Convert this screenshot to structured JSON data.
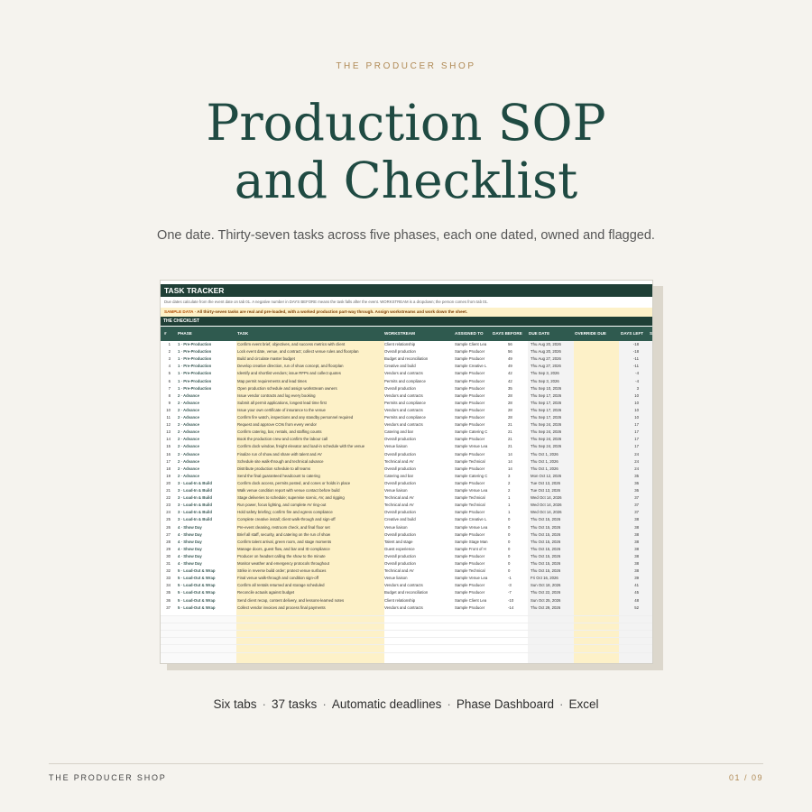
{
  "brand": "THE PRODUCER SHOP",
  "title_line1": "Production SOP",
  "title_line2": "and Checklist",
  "subtitle": "One date. Thirty-seven tasks across five phases, each one dated, owned and flagged.",
  "sheet": {
    "title": "TASK TRACKER",
    "note": "Due dates calculate from the event date on tab 01. A negative number in DAYS BEFORE means the task falls after the event. WORKSTREAM is a dropdown; the person comes from tab 01.",
    "sample_tag": "SAMPLE DATA",
    "sample_text": "All thirty-seven tasks are real and pre-loaded, with a worked production part-way through. Assign workstreams and work down the sheet.",
    "section": "THE CHECKLIST",
    "headers": [
      "#",
      "PHASE",
      "TASK",
      "WORKSTREAM",
      "ASSIGNED TO",
      "DAYS BEFORE",
      "DUE DATE",
      "OVERRIDE DUE",
      "DAYS LEFT",
      "S"
    ],
    "rows": [
      [
        "1",
        "1 · Pre-Production",
        "Confirm event brief, objectives, and success metrics with client",
        "Client relationship",
        "Sample Client Lea",
        "56",
        "Thu  Aug 20, 2026",
        "-18"
      ],
      [
        "2",
        "1 · Pre-Production",
        "Lock event date, venue, and contract; collect venue rules and floorplan",
        "Overall production",
        "Sample Producer",
        "56",
        "Thu  Aug 20, 2026",
        "-18"
      ],
      [
        "3",
        "1 · Pre-Production",
        "Build and circulate master budget",
        "Budget and reconciliation",
        "Sample Producer",
        "49",
        "Thu  Aug 27, 2026",
        "-11"
      ],
      [
        "4",
        "1 · Pre-Production",
        "Develop creative direction, run of show concept, and floorplan",
        "Creative and build",
        "Sample Creative L",
        "49",
        "Thu  Aug 27, 2026",
        "-11"
      ],
      [
        "5",
        "1 · Pre-Production",
        "Identify and shortlist vendors; issue RFPs and collect quotes",
        "Vendors and contracts",
        "Sample Producer",
        "42",
        "Thu  Sep 3, 2026",
        "-4"
      ],
      [
        "6",
        "1 · Pre-Production",
        "Map permit requirements and lead times",
        "Permits and compliance",
        "Sample Producer",
        "42",
        "Thu  Sep 3, 2026",
        "-4"
      ],
      [
        "7",
        "1 · Pre-Production",
        "Open production schedule and assign workstream owners",
        "Overall production",
        "Sample Producer",
        "35",
        "Thu  Sep 10, 2026",
        "3"
      ],
      [
        "8",
        "2 · Advance",
        "Issue vendor contracts and log every booking",
        "Vendors and contracts",
        "Sample Producer",
        "28",
        "Thu  Sep 17, 2026",
        "10"
      ],
      [
        "9",
        "2 · Advance",
        "Submit all permit applications, longest lead time first",
        "Permits and compliance",
        "Sample Producer",
        "28",
        "Thu  Sep 17, 2026",
        "10"
      ],
      [
        "10",
        "2 · Advance",
        "Issue your own certificate of insurance to the venue",
        "Vendors and contracts",
        "Sample Producer",
        "28",
        "Thu  Sep 17, 2026",
        "10"
      ],
      [
        "11",
        "2 · Advance",
        "Confirm fire watch, inspections and any standby personnel required",
        "Permits and compliance",
        "Sample Producer",
        "28",
        "Thu  Sep 17, 2026",
        "10"
      ],
      [
        "12",
        "2 · Advance",
        "Request and approve COIs from every vendor",
        "Vendors and contracts",
        "Sample Producer",
        "21",
        "Thu  Sep 24, 2026",
        "17"
      ],
      [
        "13",
        "2 · Advance",
        "Confirm catering, bar, rentals, and staffing counts",
        "Catering and bar",
        "Sample Catering C",
        "21",
        "Thu  Sep 24, 2026",
        "17"
      ],
      [
        "14",
        "2 · Advance",
        "Book the production crew and confirm the labour call",
        "Overall production",
        "Sample Producer",
        "21",
        "Thu  Sep 24, 2026",
        "17"
      ],
      [
        "15",
        "2 · Advance",
        "Confirm dock window, freight elevator and load-in schedule with the venue",
        "Venue liaison",
        "Sample Venue Lea",
        "21",
        "Thu  Sep 24, 2026",
        "17"
      ],
      [
        "16",
        "2 · Advance",
        "Finalize run of show and share with talent and AV",
        "Overall production",
        "Sample Producer",
        "14",
        "Thu  Oct 1, 2026",
        "24"
      ],
      [
        "17",
        "2 · Advance",
        "Schedule site walk-through and technical advance",
        "Technical and AV",
        "Sample Technical",
        "14",
        "Thu  Oct 1, 2026",
        "24"
      ],
      [
        "18",
        "2 · Advance",
        "Distribute production schedule to all teams",
        "Overall production",
        "Sample Producer",
        "14",
        "Thu  Oct 1, 2026",
        "24"
      ],
      [
        "19",
        "2 · Advance",
        "Send the final guaranteed headcount to catering",
        "Catering and bar",
        "Sample Catering C",
        "3",
        "Mon  Oct 12, 2026",
        "35"
      ],
      [
        "20",
        "3 · Load-In & Build",
        "Confirm dock access, permits posted, and cones or holds in place",
        "Overall production",
        "Sample Producer",
        "2",
        "Tue  Oct 13, 2026",
        "36"
      ],
      [
        "21",
        "3 · Load-In & Build",
        "Walk venue condition report with venue contact before build",
        "Venue liaison",
        "Sample Venue Lea",
        "2",
        "Tue  Oct 13, 2026",
        "36"
      ],
      [
        "22",
        "3 · Load-In & Build",
        "Stage deliveries to schedule; supervise scenic, AV, and rigging",
        "Technical and AV",
        "Sample Technical",
        "1",
        "Wed  Oct 14, 2026",
        "37"
      ],
      [
        "23",
        "3 · Load-In & Build",
        "Run power, focus lighting, and complete AV ring-out",
        "Technical and AV",
        "Sample Technical",
        "1",
        "Wed  Oct 14, 2026",
        "37"
      ],
      [
        "24",
        "3 · Load-In & Build",
        "Hold safety briefing; confirm fire and egress compliance",
        "Overall production",
        "Sample Producer",
        "1",
        "Wed  Oct 14, 2026",
        "37"
      ],
      [
        "25",
        "3 · Load-In & Build",
        "Complete creative install; client walk-through and sign-off",
        "Creative and build",
        "Sample Creative L",
        "0",
        "Thu  Oct 15, 2026",
        "38"
      ],
      [
        "26",
        "4 · Show Day",
        "Pre-event cleaning, restroom check, and final floor set",
        "Venue liaison",
        "Sample Venue Lea",
        "0",
        "Thu  Oct 15, 2026",
        "38"
      ],
      [
        "27",
        "4 · Show Day",
        "Brief all staff, security, and catering on the run of show",
        "Overall production",
        "Sample Producer",
        "0",
        "Thu  Oct 15, 2026",
        "38"
      ],
      [
        "28",
        "4 · Show Day",
        "Confirm talent arrival, green room, and stage moments",
        "Talent and stage",
        "Sample Stage Man",
        "0",
        "Thu  Oct 15, 2026",
        "38"
      ],
      [
        "29",
        "4 · Show Day",
        "Manage doors, guest flow, and bar and ID compliance",
        "Guest experience",
        "Sample Front of H",
        "0",
        "Thu  Oct 15, 2026",
        "38"
      ],
      [
        "30",
        "4 · Show Day",
        "Producer on headset calling the show to the minute",
        "Overall production",
        "Sample Producer",
        "0",
        "Thu  Oct 15, 2026",
        "38"
      ],
      [
        "31",
        "4 · Show Day",
        "Monitor weather and emergency protocols throughout",
        "Overall production",
        "Sample Producer",
        "0",
        "Thu  Oct 15, 2026",
        "38"
      ],
      [
        "32",
        "5 · Load-Out & Wrap",
        "Strike in reverse build order; protect venue surfaces",
        "Technical and AV",
        "Sample Technical",
        "0",
        "Thu  Oct 15, 2026",
        "38"
      ],
      [
        "33",
        "5 · Load-Out & Wrap",
        "Final venue walk-through and condition sign-off",
        "Venue liaison",
        "Sample Venue Lea",
        "-1",
        "Fri  Oct 16, 2026",
        "39"
      ],
      [
        "34",
        "5 · Load-Out & Wrap",
        "Confirm all rentals returned and storage scheduled",
        "Vendors and contracts",
        "Sample Producer",
        "-3",
        "Sun  Oct 18, 2026",
        "41"
      ],
      [
        "35",
        "5 · Load-Out & Wrap",
        "Reconcile actuals against budget",
        "Budget and reconciliation",
        "Sample Producer",
        "-7",
        "Thu  Oct 22, 2026",
        "45"
      ],
      [
        "36",
        "5 · Load-Out & Wrap",
        "Send client recap, content delivery, and lessons-learned notes",
        "Client relationship",
        "Sample Client Lea",
        "-10",
        "Sun  Oct 25, 2026",
        "48"
      ],
      [
        "37",
        "5 · Load-Out & Wrap",
        "Collect vendor invoices and process final payments",
        "Vendors and contracts",
        "Sample Producer",
        "-14",
        "Thu  Oct 29, 2026",
        "52"
      ]
    ]
  },
  "features": [
    "Six tabs",
    "37 tasks",
    "Automatic deadlines",
    "Phase Dashboard",
    "Excel"
  ],
  "features_sep": "·",
  "footer_left": "THE PRODUCER SHOP",
  "footer_right": "01 / 09",
  "colors": {
    "accent_green": "#1f4a42",
    "accent_gold": "#b08a55",
    "sheet_header": "#1f3f36",
    "highlight": "#fdf1c8"
  }
}
